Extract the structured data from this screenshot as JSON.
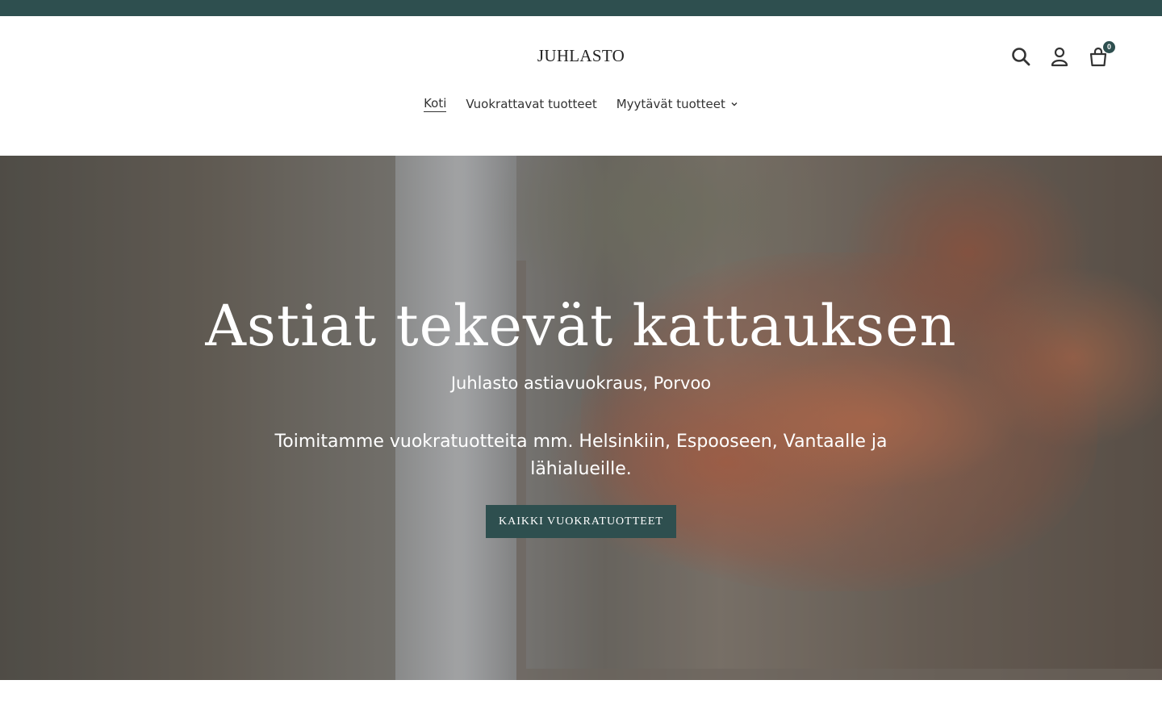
{
  "header": {
    "logo": "JUHLASTO",
    "cart_count": "0"
  },
  "icons": {
    "search": "search-icon",
    "account": "user-icon",
    "cart": "cart-icon",
    "dropdown": "chevron-down-icon"
  },
  "nav": {
    "items": [
      {
        "label": "Koti",
        "active": true
      },
      {
        "label": "Vuokrattavat tuotteet",
        "active": false
      },
      {
        "label": "Myytävät tuotteet",
        "active": false,
        "has_dropdown": true
      }
    ]
  },
  "hero": {
    "title": "Astiat tekevät kattauksen",
    "subtitle": "Juhlasto astiavuokraus, Porvoo",
    "text": "Toimitamme vuokratuotteita mm. Helsinkiin, Espooseen, Vantaalle ja lähialueille.",
    "button_label": "KAIKKI VUOKRATUOTTEET"
  },
  "colors": {
    "accent": "#2e4f4f",
    "background": "#ffffff"
  }
}
